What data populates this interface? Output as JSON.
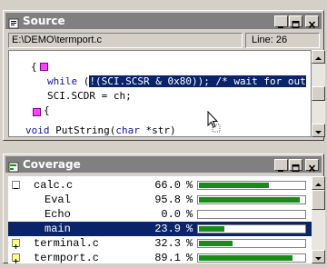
{
  "source": {
    "title": "Source",
    "path": "E:\\DEMO\\termport.c",
    "line_label": "Line: 26",
    "code": {
      "brace": "{",
      "while_kw": "while",
      "while_pre": " (",
      "while_hl": "!(SCI.SCSR & 0x80)); /* wait for out",
      "assign": "SCI.SCDR = ch;",
      "void_kw": "void",
      "void_mid": " PutString(",
      "char_kw": "char",
      "void_tail": " *str)"
    }
  },
  "coverage": {
    "title": "Coverage",
    "rows": [
      {
        "name": "calc.c",
        "value": "66.0",
        "pct": "%",
        "fraction": 0.66,
        "toggle": "minus"
      },
      {
        "name": "Eval",
        "value": "95.8",
        "pct": "%",
        "fraction": 0.958,
        "toggle": ""
      },
      {
        "name": "Echo",
        "value": "0.0",
        "pct": "%",
        "fraction": 0.0,
        "toggle": ""
      },
      {
        "name": "main",
        "value": "23.9",
        "pct": "%",
        "fraction": 0.239,
        "toggle": "",
        "selected": true
      },
      {
        "name": "terminal.c",
        "value": "32.3",
        "pct": "%",
        "fraction": 0.323,
        "toggle": "plus"
      },
      {
        "name": "termport.c",
        "value": "89.1",
        "pct": "%",
        "fraction": 0.891,
        "toggle": "plus"
      }
    ]
  },
  "colors": {
    "title_bar_inactive": "#808080",
    "selection": "#0a246a",
    "coverage_bar": "#1a8a1a",
    "breakpoint_marker": "#ff40ff"
  }
}
